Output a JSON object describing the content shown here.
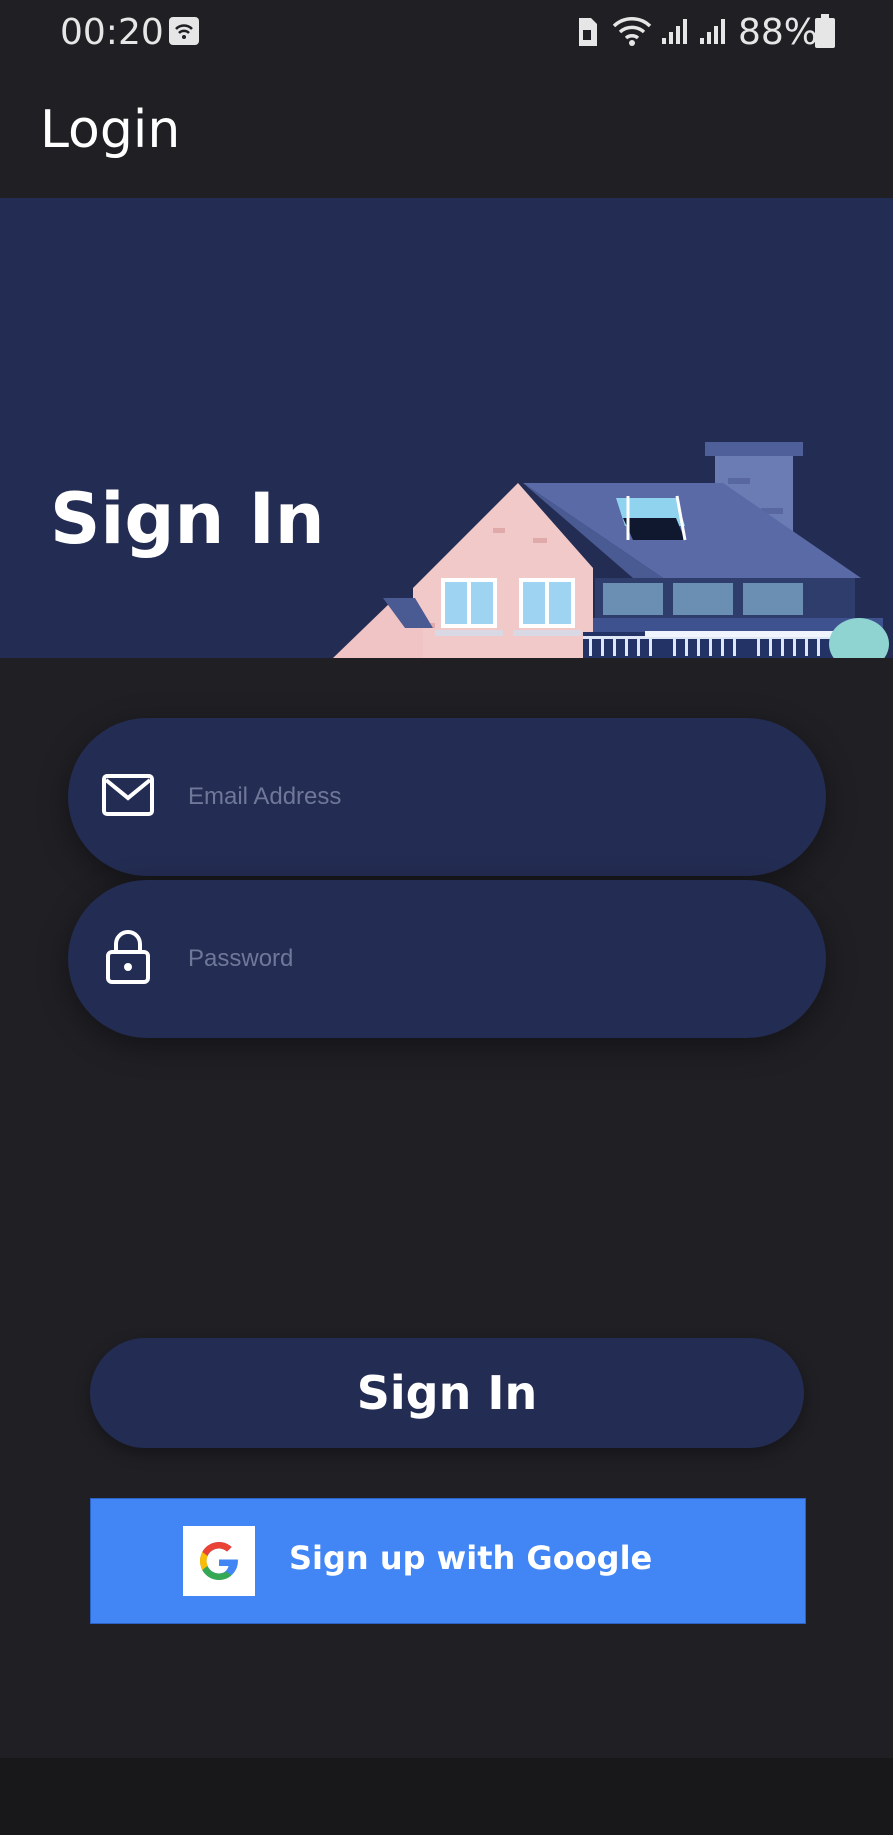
{
  "status_bar": {
    "time": "00:20",
    "battery": "88%"
  },
  "app_bar": {
    "title": "Login"
  },
  "hero": {
    "title": "Sign In"
  },
  "form": {
    "email_placeholder": "Email Address",
    "email_value": "",
    "password_placeholder": "Password",
    "password_value": ""
  },
  "buttons": {
    "sign_in_label": "Sign In",
    "google_label": "Sign up with Google"
  },
  "colors": {
    "background": "#1f1f24",
    "panel": "#232c52",
    "google_blue": "#4285f4",
    "placeholder": "#6f7899"
  },
  "icons": [
    "wifi-icon",
    "sim-icon",
    "signal-icon",
    "battery-icon",
    "mail-icon",
    "lock-icon",
    "google-g-icon"
  ]
}
